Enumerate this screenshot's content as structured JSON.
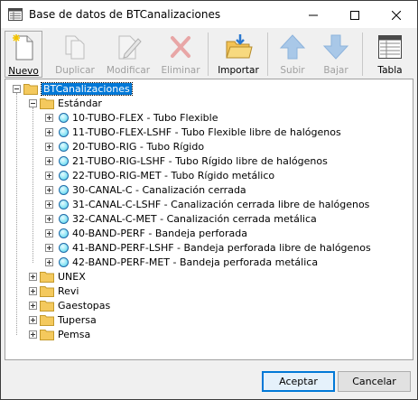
{
  "window": {
    "title": "Base de datos de BTCanalizaciones"
  },
  "toolbar": {
    "nuevo": "Nuevo",
    "duplicar": "Duplicar",
    "modificar": "Modificar",
    "eliminar": "Eliminar",
    "importar": "Importar",
    "subir": "Subir",
    "bajar": "Bajar",
    "tabla": "Tabla"
  },
  "tree": {
    "root": "BTCanalizaciones",
    "estandar": "Estándar",
    "items": [
      "10-TUBO-FLEX - Tubo Flexible",
      "11-TUBO-FLEX-LSHF - Tubo Flexible libre de halógenos",
      "20-TUBO-RIG - Tubo Rígido",
      "21-TUBO-RIG-LSHF - Tubo Rígido libre de halógenos",
      "22-TUBO-RIG-MET - Tubo Rígido metálico",
      "30-CANAL-C - Canalización cerrada",
      "31-CANAL-C-LSHF - Canalización cerrada libre de halógenos",
      "32-CANAL-C-MET - Canalización cerrada metálica",
      "40-BAND-PERF - Bandeja perforada",
      "41-BAND-PERF-LSHF - Bandeja perforada libre de halógenos",
      "42-BAND-PERF-MET - Bandeja perforada metálica"
    ],
    "groups": [
      "UNEX",
      "Revi",
      "Gaestopas",
      "Tupersa",
      "Pemsa"
    ]
  },
  "buttons": {
    "accept": "Aceptar",
    "cancel": "Cancelar"
  },
  "colors": {
    "selection": "#0078d7",
    "folder": "#f4c95d",
    "item_circle": "#3ec7e6"
  }
}
